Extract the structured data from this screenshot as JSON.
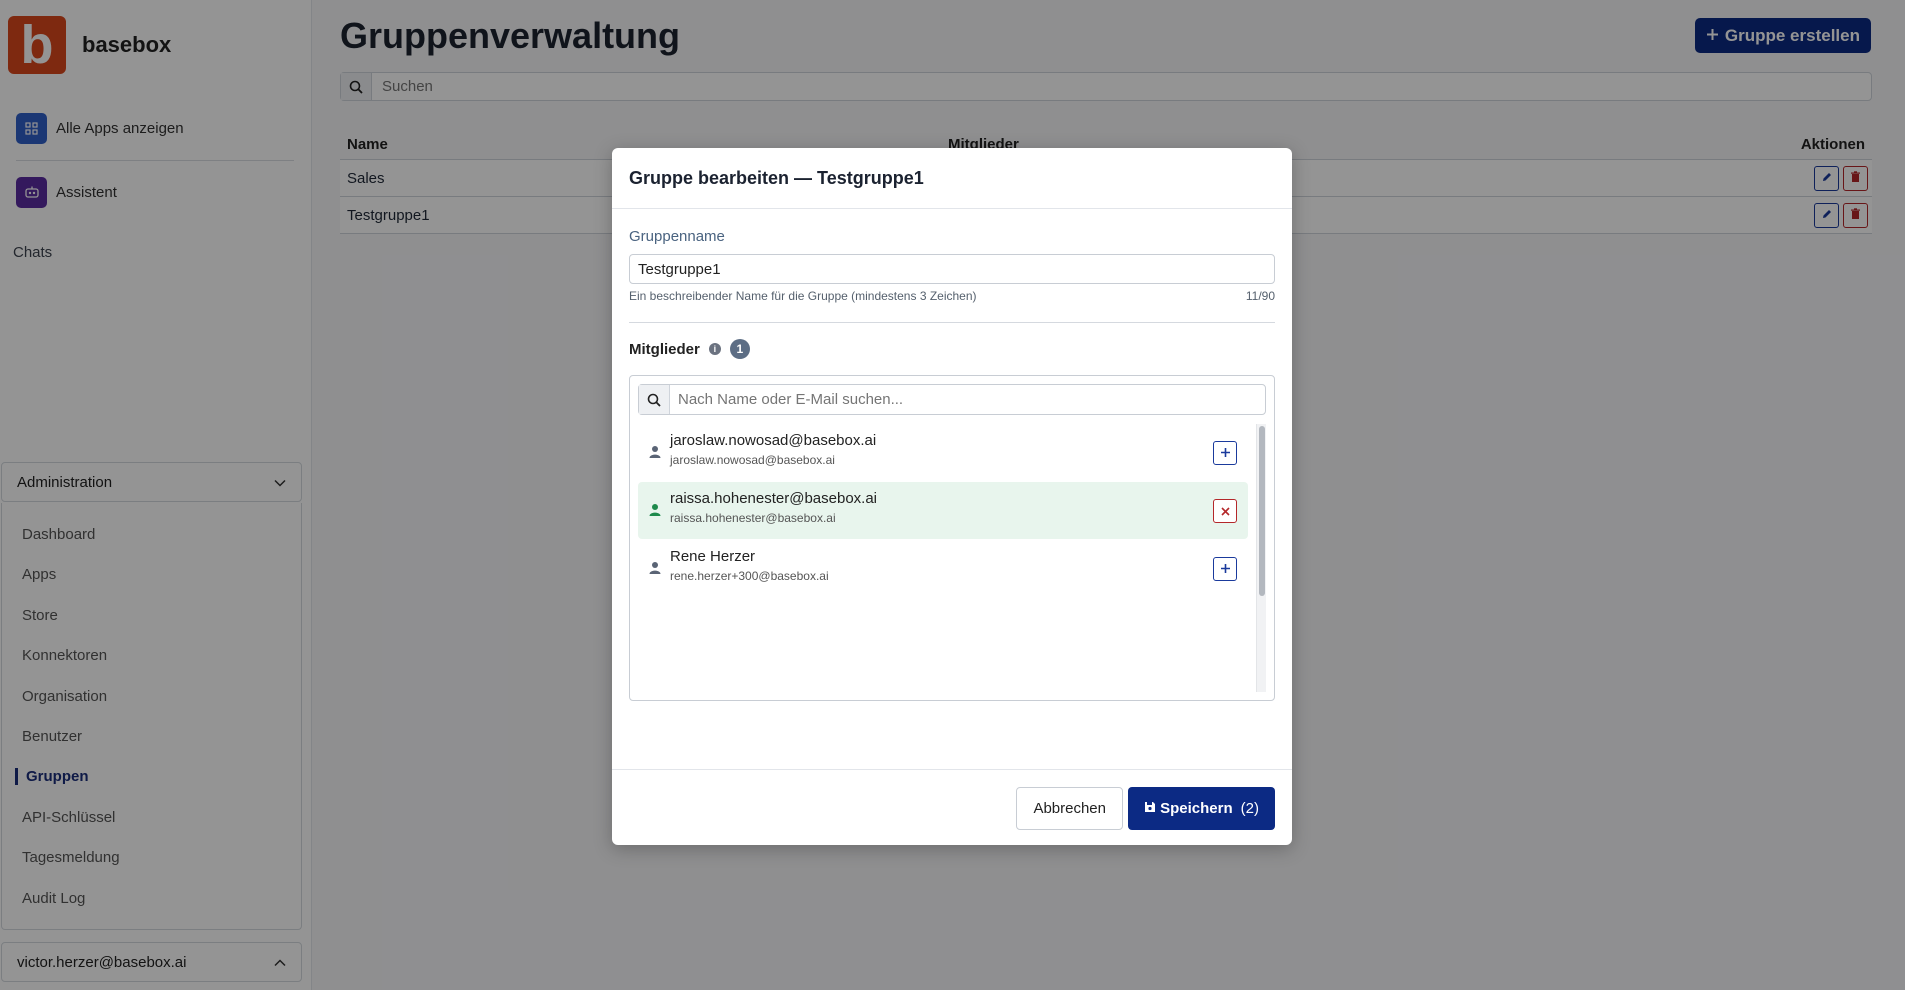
{
  "brand": {
    "logo_letter": "b",
    "name": "basebox"
  },
  "sidebar": {
    "apps_label": "Alle Apps anzeigen",
    "assistant_label": "Assistent",
    "chats_label": "Chats",
    "admin_title": "Administration",
    "admin_items": [
      {
        "label": "Dashboard"
      },
      {
        "label": "Apps"
      },
      {
        "label": "Store"
      },
      {
        "label": "Konnektoren"
      },
      {
        "label": "Organisation"
      },
      {
        "label": "Benutzer"
      },
      {
        "label": "Gruppen",
        "active": true
      },
      {
        "label": "API-Schlüssel"
      },
      {
        "label": "Tagesmeldung"
      },
      {
        "label": "Audit Log"
      }
    ],
    "user_email": "victor.herzer@basebox.ai"
  },
  "main": {
    "title": "Gruppenverwaltung",
    "create_button": "Gruppe erstellen",
    "search_placeholder": "Suchen",
    "table": {
      "columns": [
        "Name",
        "Mitglieder",
        "Aktionen"
      ],
      "rows": [
        {
          "name": "Sales"
        },
        {
          "name": "Testgruppe1"
        }
      ]
    }
  },
  "modal": {
    "title": "Gruppe bearbeiten — Testgruppe1",
    "name_label": "Gruppenname",
    "name_value": "Testgruppe1",
    "name_help": "Ein beschreibender Name für die Gruppe (mindestens 3 Zeichen)",
    "name_count": "11/90",
    "members_label": "Mitglieder",
    "members_count": "1",
    "member_search_placeholder": "Nach Name oder E-Mail suchen...",
    "members": [
      {
        "name": "jaroslaw.nowosad@basebox.ai",
        "email": "jaroslaw.nowosad@basebox.ai",
        "selected": false
      },
      {
        "name": "raissa.hohenester@basebox.ai",
        "email": "raissa.hohenester@basebox.ai",
        "selected": true
      },
      {
        "name": "Rene Herzer",
        "email": "rene.herzer+300@basebox.ai",
        "selected": false
      }
    ],
    "cancel_label": "Abbrechen",
    "save_label": "Speichern",
    "save_count": "(2)"
  },
  "colors": {
    "brand": "#d9481c",
    "primary": "#0c2a84",
    "danger": "#b4272a",
    "selected_bg": "#e8f5ed"
  }
}
